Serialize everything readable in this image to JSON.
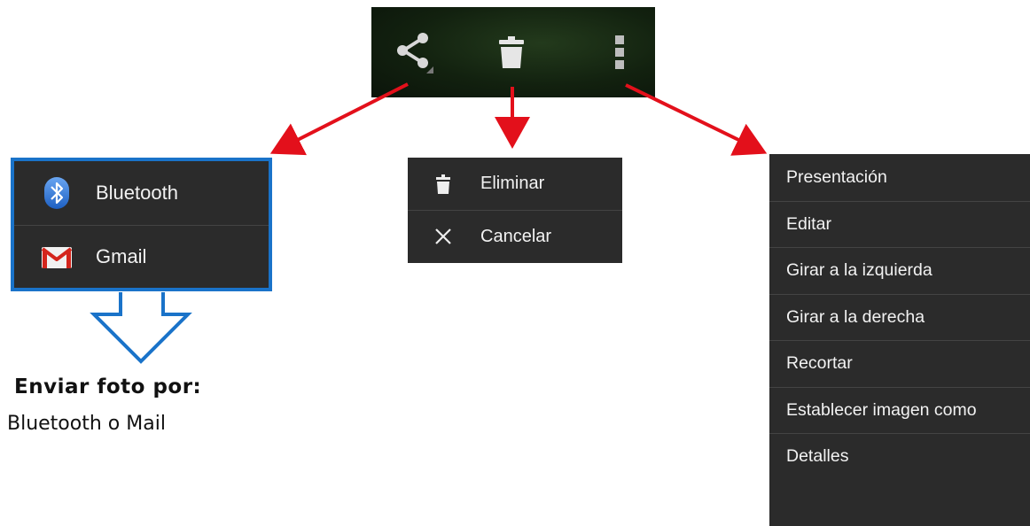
{
  "action_bar": {
    "icons": [
      "share-icon",
      "trash-icon",
      "overflow-menu-icon"
    ],
    "background_color": "#12210f"
  },
  "share_menu": {
    "items": [
      {
        "label": "Bluetooth",
        "icon": "bluetooth-icon"
      },
      {
        "label": "Gmail",
        "icon": "gmail-icon"
      }
    ],
    "highlight_color": "#1a73c9"
  },
  "delete_menu": {
    "items": [
      {
        "label": "Eliminar",
        "icon": "trash-icon"
      },
      {
        "label": "Cancelar",
        "icon": "close-icon"
      }
    ]
  },
  "overflow_menu": {
    "items": [
      {
        "label": "Presentación"
      },
      {
        "label": "Editar"
      },
      {
        "label": "Girar a la izquierda"
      },
      {
        "label": "Girar a la derecha"
      },
      {
        "label": "Recortar"
      },
      {
        "label": "Establecer imagen como"
      },
      {
        "label": "Detalles"
      }
    ]
  },
  "caption": {
    "title": "Enviar foto por:",
    "subtitle": "Bluetooth o Mail"
  },
  "colors": {
    "arrow": "#e3101b",
    "menu_background": "#2b2b2b",
    "menu_text": "#f2f2f2"
  }
}
